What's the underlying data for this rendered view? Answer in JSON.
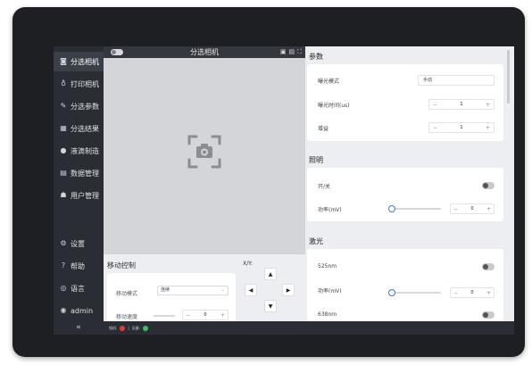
{
  "sidebar": {
    "items": [
      {
        "label": "分选相机",
        "icon": "camera-icon",
        "active": true
      },
      {
        "label": "打印相机",
        "icon": "bulb-icon"
      },
      {
        "label": "分选参数",
        "icon": "pen-icon"
      },
      {
        "label": "分选结果",
        "icon": "image-icon"
      },
      {
        "label": "液滴制造",
        "icon": "drop-icon"
      },
      {
        "label": "数据管理",
        "icon": "database-icon"
      },
      {
        "label": "用户管理",
        "icon": "users-icon"
      }
    ],
    "bottom_items": [
      {
        "label": "设置",
        "icon": "gear-icon"
      },
      {
        "label": "帮助",
        "icon": "help-icon"
      },
      {
        "label": "语言",
        "icon": "globe-icon"
      },
      {
        "label": "admin",
        "icon": "user-icon"
      }
    ],
    "collapse_glyph": "«"
  },
  "camera": {
    "title": "分选相机",
    "tools": [
      "▣",
      "▤",
      "⛶"
    ]
  },
  "move": {
    "title": "移动控制",
    "xy_label": "X/Y:",
    "mode_label": "移动模式",
    "mode_value": "连续",
    "step_label": "移动速度",
    "step_value": "0"
  },
  "params": {
    "title": "参数",
    "exposure_mode_label": "曝光模式",
    "exposure_mode_value": "手动",
    "exposure_time_label": "曝光时间(us)",
    "exposure_time_value": "1",
    "gain_label": "增益",
    "gain_value": "1"
  },
  "lighting": {
    "title": "照明",
    "switch_label": "开/关",
    "switch_on": false,
    "power_label": "功率(mV)",
    "power_value": "0"
  },
  "laser": {
    "title": "激光",
    "line1_label": "525nm",
    "line1_on": false,
    "power_label": "功率(mV)",
    "power_value": "0",
    "line2_label": "638nm",
    "line2_on": false
  },
  "status": {
    "label1": "相机:",
    "label2": "设备:",
    "color_error": "#e03b3b",
    "color_ok": "#3fbf5a"
  }
}
